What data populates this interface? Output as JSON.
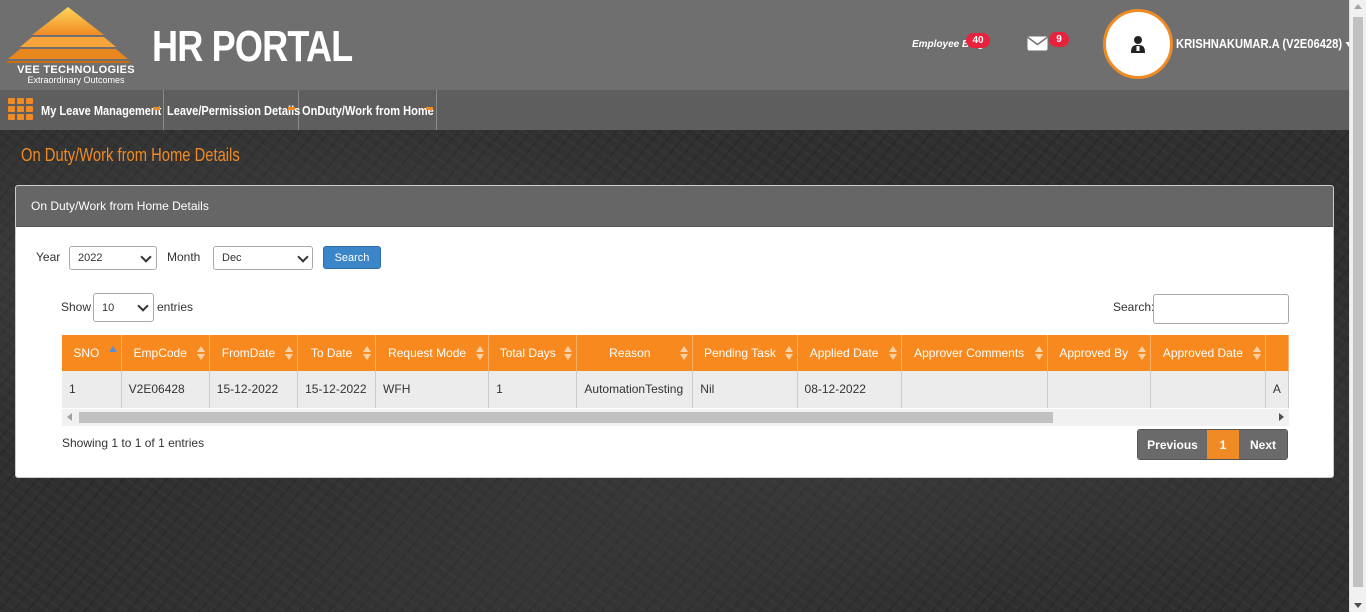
{
  "header": {
    "company_name": "VEE TECHNOLOGIES",
    "company_tagline": "Extraordinary Outcomes",
    "portal_title": "HR PORTAL",
    "blog_label": "Employee Blog",
    "blog_count": "40",
    "mail_count": "9",
    "user_name": "KRISHNAKUMAR.A (V2E06428)"
  },
  "nav": {
    "items": [
      {
        "label": "My Leave Management"
      },
      {
        "label": "Leave/Permission Details"
      },
      {
        "label": "OnDuty/Work from Home"
      }
    ]
  },
  "page": {
    "heading": "On Duty/Work from Home Details"
  },
  "panel": {
    "title": "On Duty/Work from Home Details",
    "year_label": "Year",
    "year_value": "2022",
    "month_label": "Month",
    "month_value": "Dec",
    "search_button": "Search",
    "show_label": "Show",
    "entries_value": "10",
    "entries_label": "entries",
    "search_label": "Search:",
    "search_value": ""
  },
  "table": {
    "columns": [
      "SNO",
      "EmpCode",
      "FromDate",
      "To Date",
      "Request Mode",
      "Total Days",
      "Reason",
      "Pending Task",
      "Applied Date",
      "Approver Comments",
      "Approved By",
      "Approved Date",
      ""
    ],
    "rows": [
      [
        "1",
        "V2E06428",
        "15-12-2022",
        "15-12-2022",
        "WFH",
        "1",
        "AutomationTesting",
        "Nil",
        "08-12-2022",
        "",
        "",
        "",
        "A"
      ]
    ]
  },
  "footer": {
    "info": "Showing 1 to 1 of 1 entries",
    "previous": "Previous",
    "current_page": "1",
    "next": "Next"
  },
  "colors": {
    "accent": "#f7891e",
    "header_bg": "#6f6f6f",
    "badge": "#e8213d",
    "search_button": "#3a86c8"
  }
}
